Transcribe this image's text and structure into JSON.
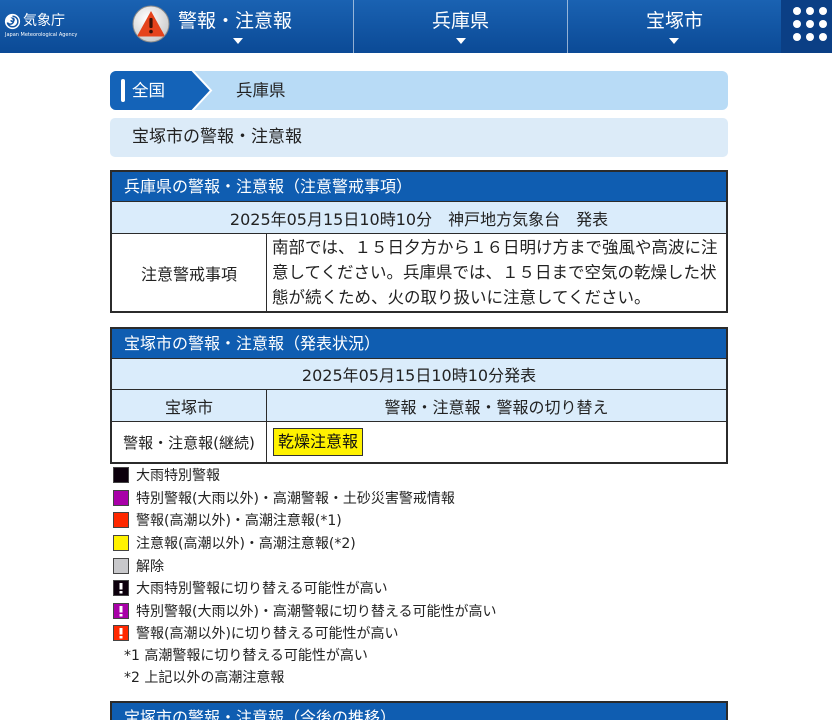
{
  "header": {
    "logo_text": "気象庁",
    "logo_subtext": "Japan Meteorological Agency",
    "logo_icon": "jma-logo-icon",
    "nav": [
      {
        "label": "警報・注意報",
        "icon": "warning-icon"
      },
      {
        "label": "兵庫県"
      },
      {
        "label": "宝塚市"
      }
    ],
    "menu_icon": "grid-menu-icon"
  },
  "breadcrumb": {
    "root": "全国",
    "current": "兵庫県"
  },
  "page_title": "宝塚市の警報・注意報",
  "prefecture_table": {
    "title": "兵庫県の警報・注意報（注意警戒事項）",
    "issued": "2025年05月15日10時10分　神戸地方気象台　発表",
    "row_label": "注意警戒事項",
    "row_text": "南部では、１５日夕方から１６日明け方まで強風や高波に注意してください。兵庫県では、１５日まで空気の乾燥した状態が続くため、火の取り扱いに注意してください。"
  },
  "city_table": {
    "title": "宝塚市の警報・注意報（発表状況）",
    "issued": "2025年05月15日10時10分発表",
    "col_area": "宝塚市",
    "col_switch": "警報・注意報・警報の切り替え",
    "status_label": "警報・注意報(継続)",
    "warnings": [
      {
        "label": "乾燥注意報",
        "color": "#fff200"
      }
    ]
  },
  "legend": [
    {
      "label": "大雨特別警報",
      "color": "#0c000c"
    },
    {
      "label": "特別警報(大雨以外)・高潮警報・土砂災害警戒情報",
      "color": "#a800a8"
    },
    {
      "label": "警報(高潮以外)・高潮注意報(*1)",
      "color": "#ff2800"
    },
    {
      "label": "注意報(高潮以外)・高潮注意報(*2)",
      "color": "#fff200"
    },
    {
      "label": "解除",
      "color": "#c8c8cb"
    },
    {
      "label": "大雨特別警報に切り替える可能性が高い",
      "color": "#0c000c",
      "icon": "exclamation-icon"
    },
    {
      "label": "特別警報(大雨以外)・高潮警報に切り替える可能性が高い",
      "color": "#a800a8",
      "icon": "exclamation-icon"
    },
    {
      "label": "警報(高潮以外)に切り替える可能性が高い",
      "color": "#ff2800",
      "icon": "exclamation-icon"
    }
  ],
  "notes": [
    "*1 高潮警報に切り替える可能性が高い",
    "*2 上記以外の高潮注意報"
  ],
  "forecast_table": {
    "title": "宝塚市の警報・注意報（今後の推移）"
  },
  "colors": {
    "header_top": "#1a62b2",
    "header_bottom": "#0b4a96",
    "menu_button": "#0b3f85",
    "table_header": "#0f5db1",
    "row_light": "#daecfb",
    "breadcrumb_dark": "#1463b8",
    "breadcrumb_light": "#b8dbf6",
    "title_background": "#dcebf8"
  }
}
